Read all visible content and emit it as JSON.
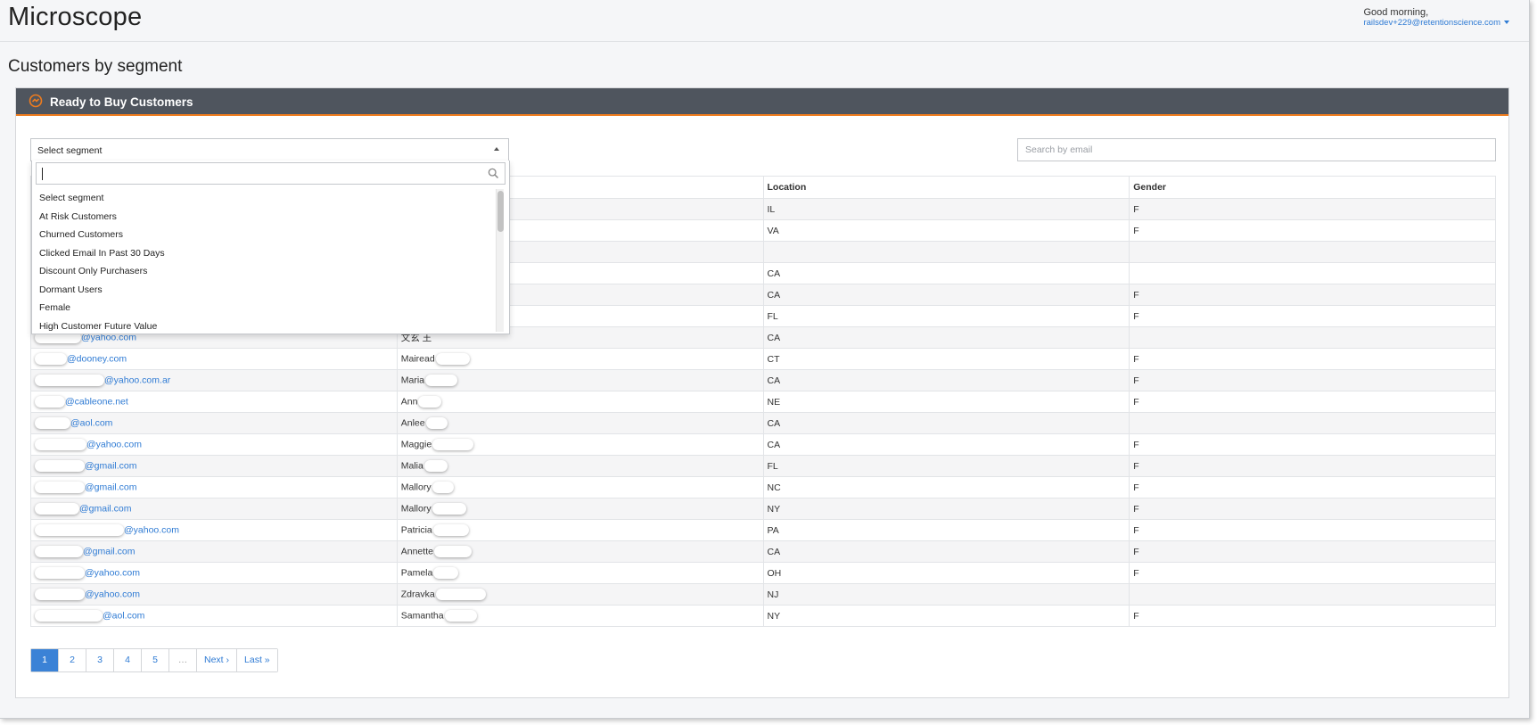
{
  "app": {
    "title": "Microscope"
  },
  "user": {
    "greeting": "Good morning,",
    "email": "railsdev+229@retentionscience.com"
  },
  "page": {
    "title": "Customers by segment"
  },
  "panel": {
    "title": "Ready to Buy Customers",
    "accent_color": "#ef7c1e",
    "header_color": "#4f555e"
  },
  "segment_select": {
    "value": "Select segment"
  },
  "search": {
    "placeholder": "Search by email"
  },
  "dropdown": {
    "search_value": "",
    "options": [
      "Select segment",
      "At Risk Customers",
      "Churned Customers",
      "Clicked Email In Past 30 Days",
      "Discount Only Purchasers",
      "Dormant Users",
      "Female",
      "High Customer Future Value"
    ]
  },
  "table": {
    "columns": [
      "",
      "",
      "Location",
      "Gender"
    ],
    "rows": [
      {
        "email": "",
        "name": "",
        "location": "IL",
        "gender": "F"
      },
      {
        "email": "",
        "name": "",
        "location": "VA",
        "gender": "F"
      },
      {
        "email": "",
        "name": "",
        "location": "",
        "gender": ""
      },
      {
        "email": "",
        "name": "",
        "location": "CA",
        "gender": ""
      },
      {
        "email": "",
        "name": "",
        "location": "CA",
        "gender": "F"
      },
      {
        "email": "",
        "name": "",
        "location": "FL",
        "gender": "F"
      },
      {
        "email": "@yahoo.com",
        "name": "文玄 王",
        "location": "CA",
        "gender": ""
      },
      {
        "email": "@dooney.com",
        "name": "Mairead",
        "location": "CT",
        "gender": "F"
      },
      {
        "email": "@yahoo.com.ar",
        "name": "Maria",
        "location": "CA",
        "gender": "F"
      },
      {
        "email": "@cableone.net",
        "name": "Ann",
        "location": "NE",
        "gender": "F"
      },
      {
        "email": "@aol.com",
        "name": "Anlee",
        "location": "CA",
        "gender": ""
      },
      {
        "email": "@yahoo.com",
        "name": "Maggie",
        "location": "CA",
        "gender": "F"
      },
      {
        "email": "@gmail.com",
        "name": "Malia",
        "location": "FL",
        "gender": "F"
      },
      {
        "email": "@gmail.com",
        "name": "Mallory",
        "location": "NC",
        "gender": "F"
      },
      {
        "email": "@gmail.com",
        "name": "Mallory",
        "location": "NY",
        "gender": "F"
      },
      {
        "email": "@yahoo.com",
        "name": "Patricia",
        "location": "PA",
        "gender": "F"
      },
      {
        "email": "@gmail.com",
        "name": "Annette",
        "location": "CA",
        "gender": "F"
      },
      {
        "email": "@yahoo.com",
        "name": "Pamela",
        "location": "OH",
        "gender": "F"
      },
      {
        "email": "@yahoo.com",
        "name": "Zdravka",
        "location": "NJ",
        "gender": ""
      },
      {
        "email": "@aol.com",
        "name": "Samantha",
        "location": "NY",
        "gender": "F"
      }
    ]
  },
  "pagination": {
    "pages": [
      "1",
      "2",
      "3",
      "4",
      "5",
      "…"
    ],
    "active": "1",
    "next_label": "Next ›",
    "last_label": "Last »"
  },
  "colors": {
    "link": "#2f7bd4",
    "active_page": "#3b82d6"
  }
}
